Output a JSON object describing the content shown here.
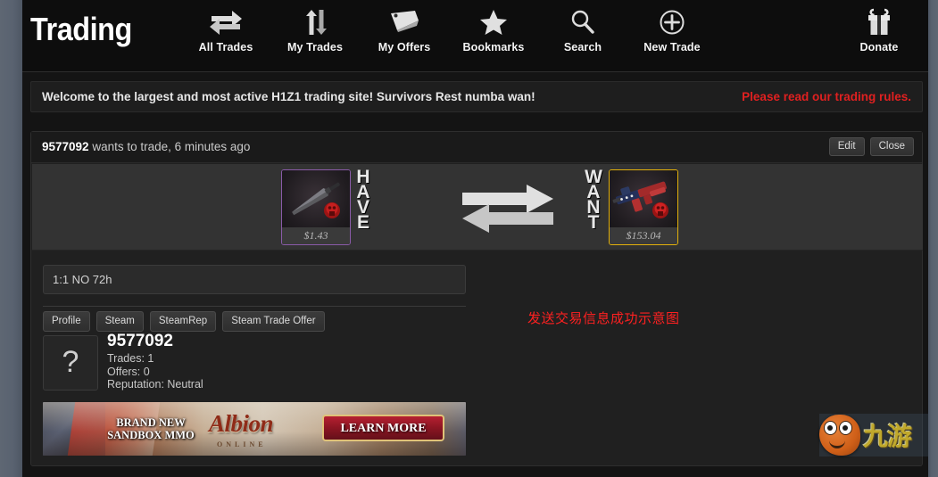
{
  "header": {
    "brand": "Trading",
    "nav": [
      {
        "label": "All Trades",
        "icon": "two-way-arrows-icon"
      },
      {
        "label": "My Trades",
        "icon": "up-down-arrows-icon"
      },
      {
        "label": "My Offers",
        "icon": "price-tag-icon"
      },
      {
        "label": "Bookmarks",
        "icon": "star-icon"
      },
      {
        "label": "Search",
        "icon": "search-icon"
      },
      {
        "label": "New Trade",
        "icon": "plus-circle-icon"
      }
    ],
    "donate": {
      "label": "Donate",
      "icon": "gift-icon"
    }
  },
  "welcome": {
    "message": "Welcome to the largest and most active H1Z1 trading site! Survivors Rest numba wan!",
    "rules_link": "Please read our trading rules.",
    "rules_color": "#e02020"
  },
  "trade": {
    "user_id": "9577092",
    "headline_rest": " wants to trade, 6 minutes ago",
    "edit_label": "Edit",
    "close_label": "Close",
    "have": {
      "label_letters": [
        "H",
        "A",
        "V",
        "E"
      ],
      "item_name": "machete",
      "price": "$1.43",
      "border_color": "#8a5ba8"
    },
    "want": {
      "label_letters": [
        "W",
        "A",
        "N",
        "T"
      ],
      "item_name": "assault-rifle",
      "price": "$153.04",
      "border_color": "#e3b10b"
    },
    "description": "1:1 NO 72h",
    "link_buttons": [
      "Profile",
      "Steam",
      "SteamRep",
      "Steam Trade Offer"
    ],
    "avatar_glyph": "?",
    "user_stats": {
      "name": "9577092",
      "trades": "Trades: 1",
      "offers": "Offers: 0",
      "reputation": "Reputation: Neutral"
    }
  },
  "annotation": {
    "text": "发送交易信息成功示意图",
    "color": "#ff2020"
  },
  "ad": {
    "tagline_line1": "BRAND NEW",
    "tagline_line2": "SANDBOX MMO",
    "logo": "Albion",
    "logo_sub": "ONLINE",
    "cta": "LEARN MORE"
  },
  "watermark": {
    "text": "九游"
  }
}
